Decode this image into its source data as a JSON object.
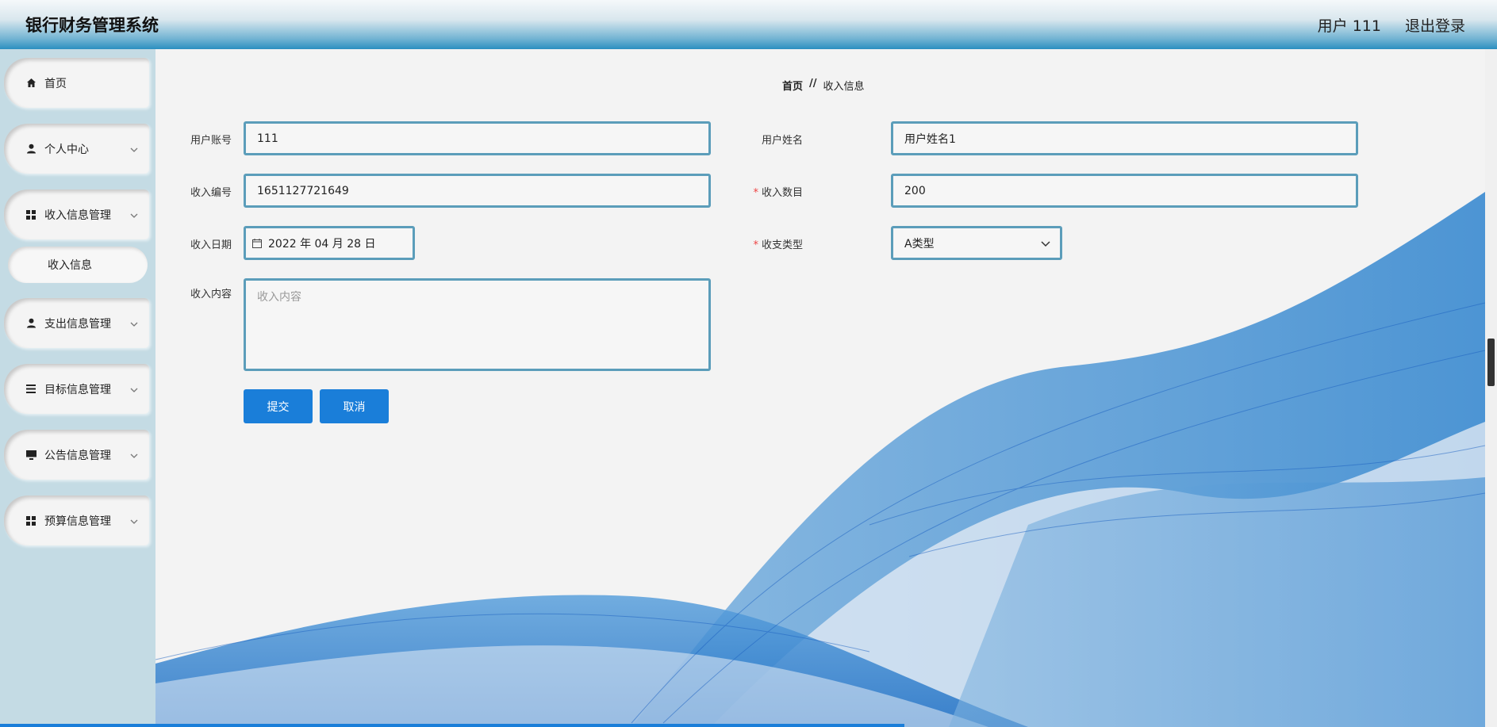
{
  "header": {
    "title": "银行财务管理系统",
    "user": "用户 111",
    "logout": "退出登录"
  },
  "sidebar": {
    "items": [
      {
        "label": "首页",
        "icon": "home-icon"
      },
      {
        "label": "个人中心",
        "icon": "user-icon"
      },
      {
        "label": "收入信息管理",
        "icon": "grid-icon"
      },
      {
        "label": "收入信息"
      },
      {
        "label": "支出信息管理",
        "icon": "user-icon"
      },
      {
        "label": "目标信息管理",
        "icon": "list-icon"
      },
      {
        "label": "公告信息管理",
        "icon": "monitor-icon"
      },
      {
        "label": "预算信息管理",
        "icon": "grid-icon"
      }
    ]
  },
  "breadcrumb": {
    "home": "首页",
    "separator": "//",
    "current": "收入信息"
  },
  "form": {
    "account_label": "用户账号",
    "account_value": "111",
    "name_label": "用户姓名",
    "name_value": "用户姓名1",
    "code_label": "收入编号",
    "code_value": "1651127721649",
    "amount_label": "收入数目",
    "amount_value": "200",
    "date_label": "收入日期",
    "date_value": "2022 年 04 月 28 日",
    "type_label": "收支类型",
    "type_value": "A类型",
    "content_label": "收入内容",
    "content_placeholder": "收入内容",
    "required_mark": "*"
  },
  "buttons": {
    "submit": "提交",
    "cancel": "取消"
  },
  "colors": {
    "accent": "#1a7ed9",
    "border": "#5b9dba",
    "sidebar": "#c4dbe4"
  }
}
